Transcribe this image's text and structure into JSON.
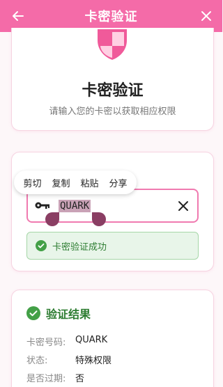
{
  "header": {
    "title": "卡密验证",
    "back_icon": "arrow-left-icon",
    "close_icon": "close-icon"
  },
  "intro_card": {
    "title": "卡密验证",
    "subtitle": "请输入您的卡密以获取相应权限",
    "icon": "shield-icon"
  },
  "context_menu": {
    "items": [
      "剪切",
      "复制",
      "粘贴",
      "分享"
    ]
  },
  "input": {
    "value": "QUARK",
    "placeholder": ""
  },
  "success": {
    "message": "卡密验证成功"
  },
  "result": {
    "title": "验证结果",
    "rows": [
      {
        "label": "卡密号码:",
        "value": "QUARK"
      },
      {
        "label": "状态:",
        "value": "特殊权限"
      },
      {
        "label": "是否过期:",
        "value": "否"
      }
    ]
  },
  "colors": {
    "accent": "#f46ba8",
    "success": "#43a047"
  }
}
